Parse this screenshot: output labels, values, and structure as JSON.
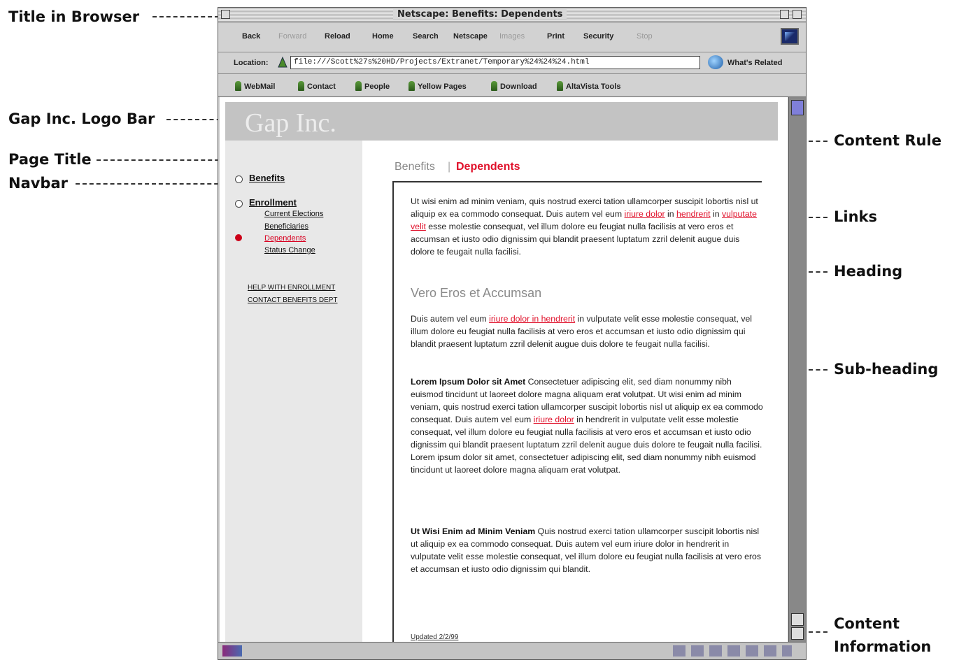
{
  "callouts": {
    "title_in_browser": "Title in Browser",
    "logo_bar": "Gap Inc. Logo Bar",
    "page_title": "Page Title",
    "navbar": "Navbar",
    "content_rule": "Content Rule",
    "links": "Links",
    "heading": "Heading",
    "sub_heading": "Sub-heading",
    "content_info_1": "Content",
    "content_info_2": "Information"
  },
  "window": {
    "title": "Netscape: Benefits: Dependents"
  },
  "toolbar": {
    "back": "Back",
    "forward": "Forward",
    "reload": "Reload",
    "home": "Home",
    "search": "Search",
    "netscape": "Netscape",
    "images": "Images",
    "print": "Print",
    "security": "Security",
    "stop": "Stop"
  },
  "location": {
    "label": "Location:",
    "url": "file:///Scott%27s%20HD/Projects/Extranet/Temporary%24%24%24.html",
    "related": "What's Related"
  },
  "personal": [
    "WebMail",
    "Contact",
    "People",
    "Yellow Pages",
    "Download",
    "AltaVista Tools"
  ],
  "logo": "Gap Inc.",
  "nav": {
    "benefits": "Benefits",
    "enrollment": "Enrollment",
    "sub": [
      "Current Elections",
      "Beneficiaries",
      "Dependents",
      "Status Change"
    ],
    "help": "HELP WITH ENROLLMENT",
    "contact": "CONTACT BENEFITS DEPT"
  },
  "page_title": {
    "section": "Benefits",
    "separator": "|",
    "current": "Dependents"
  },
  "article": {
    "p1_a": "Ut wisi enim ad minim veniam, quis nostrud exerci tation ullamcorper suscipit lobortis nisl ut aliquip ex ea commodo consequat. Duis autem vel eum ",
    "link1": "iriure dolor",
    "p1_b": " in ",
    "link2": "hendrerit",
    "p1_c": " in ",
    "link3": "vulputate velit",
    "p1_d": " esse molestie consequat, vel illum dolore eu feugiat nulla facilisis at vero eros et accumsan et iusto odio dignissim qui blandit praesent luptatum zzril delenit augue duis dolore te feugait nulla facilisi.",
    "heading": "Vero Eros et Accumsan",
    "p2_a": "Duis autem vel eum ",
    "link4": "iriure dolor in hendrerit",
    "p2_b": " in vulputate velit esse molestie consequat, vel illum dolore eu feugiat nulla facilisis at vero eros et accumsan et iusto odio dignissim qui blandit praesent luptatum zzril delenit augue duis dolore te feugait nulla facilisi.",
    "sub1": "Lorem Ipsum Dolor sit Amet",
    "p3_a": " Consectetuer adipiscing elit, sed diam nonummy nibh euismod tincidunt ut laoreet dolore magna aliquam erat volutpat. Ut wisi enim ad minim veniam, quis nostrud exerci tation ullamcorper suscipit lobortis nisl ut aliquip ex ea commodo consequat. Duis autem vel eum ",
    "link5": "iriure dolor",
    "p3_b": " in hendrerit in vulputate velit esse molestie consequat, vel illum dolore eu feugiat nulla facilisis at vero eros et accumsan et iusto odio dignissim qui blandit praesent luptatum zzril delenit augue duis dolore te feugait nulla facilisi. Lorem ipsum dolor sit amet, consectetuer adipiscing elit, sed diam nonummy nibh euismod tincidunt ut laoreet dolore magna aliquam erat volutpat.",
    "sub2": "Ut Wisi Enim ad Minim Veniam",
    "p4": " Quis nostrud exerci tation ullamcorper suscipit lobortis nisl ut aliquip ex ea commodo consequat. Duis autem vel eum iriure dolor in hendrerit in vulputate velit esse molestie consequat, vel illum dolore eu feugiat nulla facilisis at vero eros et accumsan et iusto odio dignissim qui blandit.",
    "updated": "Updated 2/2/99"
  },
  "colors": {
    "accent_red": "#e0102a",
    "logo_bar": "#c3c3c3",
    "nav_bg": "#e8e8e8"
  }
}
